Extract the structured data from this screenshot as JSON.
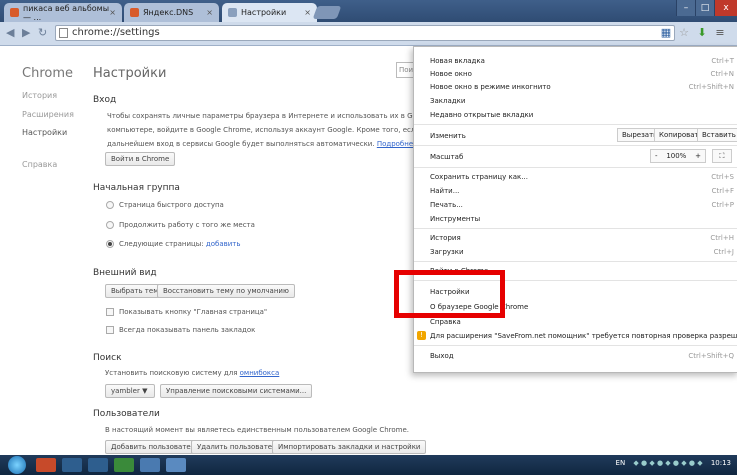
{
  "tabs": [
    {
      "title": "пикаса веб альбомы — ...",
      "color": "#d85b2a"
    },
    {
      "title": "Яндекс.DNS",
      "color": "#d85b2a"
    },
    {
      "title": "Настройки",
      "color": "#8aa0be"
    }
  ],
  "window_controls": [
    "–",
    "□",
    "x"
  ],
  "address": "chrome://settings",
  "sidebar": {
    "brand": "Chrome",
    "items": [
      "История",
      "Расширения",
      "Настройки",
      "Справка"
    ]
  },
  "main": {
    "title": "Настройки",
    "search_placeholder": "Пои",
    "signin": {
      "heading": "Вход",
      "line1": "Чтобы сохранять личные параметры браузера в Интернете и использовать их в Google Chrome на люб",
      "line2": "компьютере, войдите в Google Chrome, используя аккаунт Google. Кроме того, если вы войдете в брау",
      "line3": "дальнейшем вход в сервисы Google будет выполняться автоматически.",
      "more_link": "Подробнее...",
      "button": "Войти в Chrome"
    },
    "startup": {
      "heading": "Начальная группа",
      "options": [
        "Страница быстрого доступа",
        "Продолжить работу с того же места",
        "Следующие страницы:"
      ],
      "add_link": "добавить"
    },
    "appearance": {
      "heading": "Внешний вид",
      "choose_theme": "Выбрать тему",
      "reset_theme": "Восстановить тему по умолчанию",
      "show_home": "Показывать кнопку \"Главная страница\"",
      "show_bookmarks": "Всегда показывать панель закладок"
    },
    "search": {
      "heading": "Поиск",
      "text": "Установить поисковую систему для",
      "omnibox_link": "омнибокса",
      "engine": "yambler",
      "manage": "Управление поисковыми системами..."
    },
    "users": {
      "heading": "Пользователи",
      "text": "В настоящий момент вы являетесь единственным пользователем Google Chrome.",
      "add": "Добавить пользователя...",
      "remove": "Удалить пользователя",
      "import": "Импортировать закладки и настройки"
    }
  },
  "menu": {
    "new_tab": "Новая вкладка",
    "new_tab_sc": "Ctrl+T",
    "new_window": "Новое окно",
    "new_window_sc": "Ctrl+N",
    "incognito": "Новое окно в режиме инкогнито",
    "incognito_sc": "Ctrl+Shift+N",
    "bookmarks": "Закладки",
    "recent_tabs": "Недавно открытые вкладки",
    "edit": "Изменить",
    "cut": "Вырезать",
    "copy": "Копировать",
    "paste": "Вставить",
    "zoom": "Масштаб",
    "zoom_minus": "-",
    "zoom_value": "100%",
    "zoom_plus": "+",
    "save_as": "Сохранить страницу как...",
    "save_as_sc": "Ctrl+S",
    "find": "Найти...",
    "find_sc": "Ctrl+F",
    "print": "Печать...",
    "print_sc": "Ctrl+P",
    "tools": "Инструменты",
    "history": "История",
    "history_sc": "Ctrl+H",
    "downloads": "Загрузки",
    "downloads_sc": "Ctrl+J",
    "signin": "Войти в Chrome...",
    "settings": "Настройки",
    "about": "О браузере Google Chrome",
    "help": "Справка",
    "warning": "Для расширения \"SaveFrom.net помощник\" требуется повторная проверка разрешений",
    "exit": "Выход",
    "exit_sc": "Ctrl+Shift+Q"
  },
  "taskbar": {
    "lang": "EN",
    "clock": "10:13"
  }
}
